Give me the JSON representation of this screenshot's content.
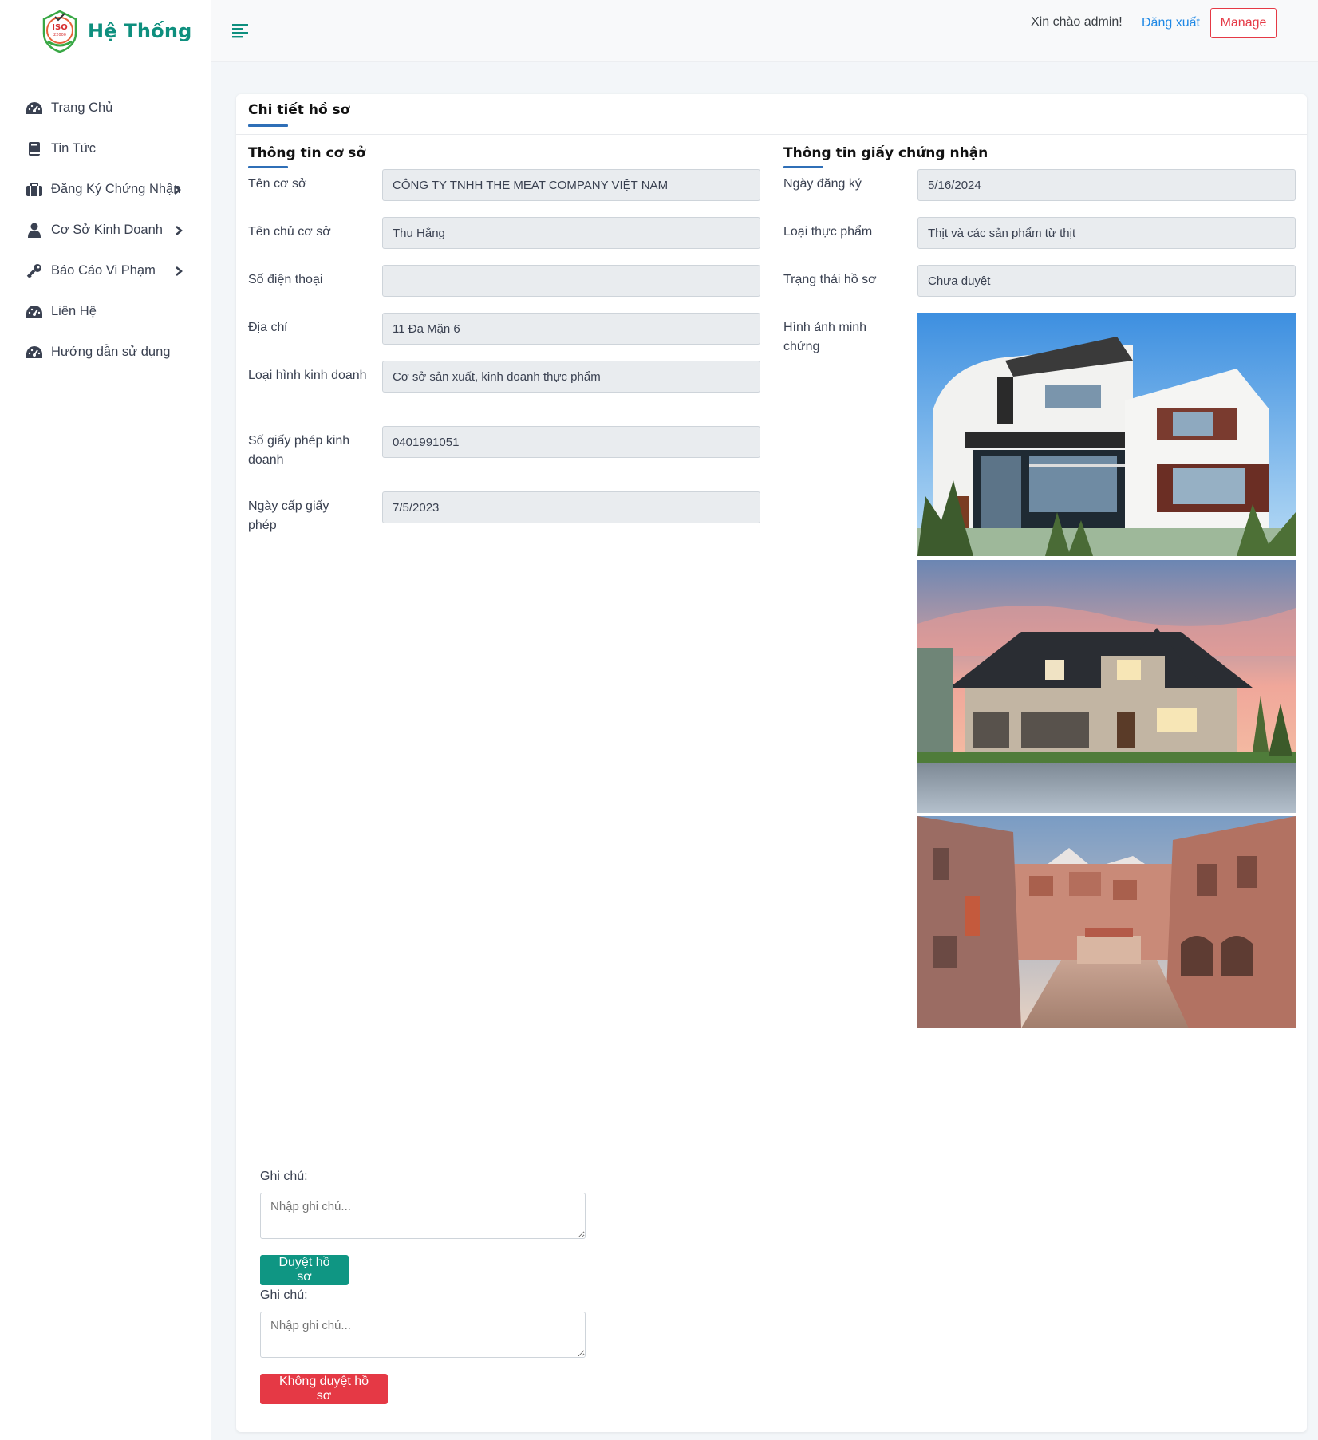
{
  "brand": {
    "title": "Hệ Thống",
    "logo_icon": "iso-badge-icon"
  },
  "nav": [
    {
      "label": "Trang Chủ",
      "icon": "dashboard-icon",
      "has_submenu": false
    },
    {
      "label": "Tin Tức",
      "icon": "book-icon",
      "has_submenu": false
    },
    {
      "label": "Đăng Ký Chứng Nhận",
      "icon": "briefcase-icon",
      "has_submenu": true
    },
    {
      "label": "Cơ Sở Kinh Doanh",
      "icon": "user-icon",
      "has_submenu": true
    },
    {
      "label": "Báo Cáo Vi Phạm",
      "icon": "key-icon",
      "has_submenu": true
    },
    {
      "label": "Liên Hệ",
      "icon": "dashboard-icon",
      "has_submenu": false
    },
    {
      "label": "Hướng dẫn sử dụng",
      "icon": "dashboard-icon",
      "has_submenu": false
    }
  ],
  "topbar": {
    "greeting": "Xin chào admin!",
    "logout": "Đăng xuất",
    "manage": "Manage"
  },
  "page": {
    "title": "Chi tiết hồ sơ",
    "facility_section": {
      "title": "Thông tin cơ sở",
      "fields": [
        {
          "label": "Tên cơ sở",
          "value": "CÔNG TY TNHH THE MEAT COMPANY VIỆT NAM"
        },
        {
          "label": "Tên chủ cơ sở",
          "value": "Thu Hằng"
        },
        {
          "label": "Số điện thoại",
          "value": ""
        },
        {
          "label": "Địa chỉ",
          "value": "11 Đa Mặn 6"
        },
        {
          "label": "Loại hình kinh doanh",
          "value": "Cơ sở sản xuất, kinh doanh thực phẩm"
        },
        {
          "label": "Số giấy phép kinh doanh",
          "value": "0401991051"
        },
        {
          "label": "Ngày cấp giấy phép",
          "value": "7/5/2023"
        }
      ]
    },
    "certificate_section": {
      "title": "Thông tin giấy chứng nhận",
      "fields": [
        {
          "label": "Ngày đăng ký",
          "value": "5/16/2024"
        },
        {
          "label": "Loại thực phẩm",
          "value": "Thịt và các sản phẩm từ thịt"
        },
        {
          "label": "Trạng thái hồ sơ",
          "value": "Chưa duyệt"
        }
      ],
      "evidence_label": "Hình ảnh minh chứng"
    },
    "approve": {
      "note_label": "Ghi chú:",
      "note_placeholder": "Nhập ghi chú...",
      "button": "Duyệt hồ sơ"
    },
    "reject": {
      "note_label": "Ghi chú:",
      "note_placeholder": "Nhập ghi chú...",
      "button": "Không duyệt hồ sơ"
    }
  },
  "colors": {
    "brand": "#0e8f7e",
    "approve": "#0f9683",
    "reject": "#e53945",
    "link": "#1e88e5",
    "underline": "#2f6fb7"
  }
}
